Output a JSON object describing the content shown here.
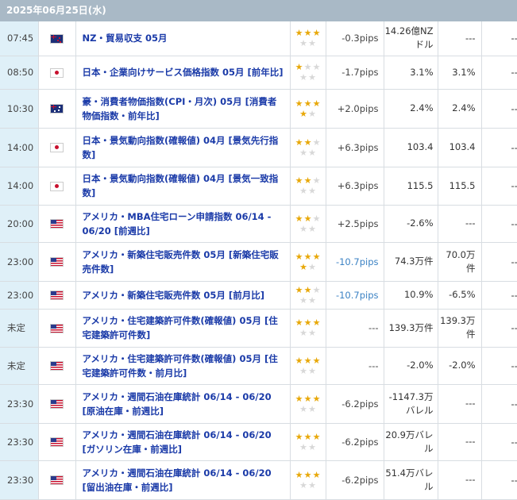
{
  "date_header": "2025年06月25日(水)",
  "rows": [
    {
      "time": "07:45",
      "flag": "nz",
      "name": "NZ・貿易収支 05月",
      "stars_full": 3,
      "stars_half": 0,
      "pips": "-0.3pips",
      "pips_blue": false,
      "result": "14.26億NZドル",
      "forecast": "---",
      "previous": "---",
      "h": 43
    },
    {
      "time": "08:50",
      "flag": "jp",
      "name": "日本・企業向けサービス価格指数 05月 [前年比]",
      "stars_full": 1,
      "stars_half": 0,
      "pips": "-1.7pips",
      "pips_blue": false,
      "result": "3.1%",
      "forecast": "3.1%",
      "previous": "---",
      "h": 42
    },
    {
      "time": "10:30",
      "flag": "au",
      "name": "豪・消費者物価指数(CPI・月次) 05月 [消費者物価指数・前年比]",
      "stars_full": 4,
      "stars_half": 0,
      "pips": "+2.0pips",
      "pips_blue": false,
      "result": "2.4%",
      "forecast": "2.4%",
      "previous": "---",
      "h": 49
    },
    {
      "time": "14:00",
      "flag": "jp",
      "name": "日本・景気動向指数(確報値) 04月 [景気先行指数]",
      "stars_full": 2,
      "stars_half": 0,
      "pips": "+6.3pips",
      "pips_blue": false,
      "result": "103.4",
      "forecast": "103.4",
      "previous": "---",
      "h": 49
    },
    {
      "time": "14:00",
      "flag": "jp",
      "name": "日本・景気動向指数(確報値) 04月 [景気一致指数]",
      "stars_full": 2,
      "stars_half": 0,
      "pips": "+6.3pips",
      "pips_blue": false,
      "result": "115.5",
      "forecast": "115.5",
      "previous": "---",
      "h": 48
    },
    {
      "time": "20:00",
      "flag": "us",
      "name": "アメリカ・MBA住宅ローン申請指数 06/14 - 06/20 [前週比]",
      "stars_full": 2,
      "stars_half": 0,
      "pips": "+2.5pips",
      "pips_blue": false,
      "result": "-2.6%",
      "forecast": "---",
      "previous": "---",
      "h": 47
    },
    {
      "time": "23:00",
      "flag": "us",
      "name": "アメリカ・新築住宅販売件数 05月 [新築住宅販売件数]",
      "stars_full": 4,
      "stars_half": 0,
      "pips": "-10.7pips",
      "pips_blue": true,
      "result": "74.3万件",
      "forecast": "70.0万件",
      "previous": "---",
      "h": 49
    },
    {
      "time": "23:00",
      "flag": "us",
      "name": "アメリカ・新築住宅販売件数 05月 [前月比]",
      "stars_full": 2,
      "stars_half": 0,
      "pips": "-10.7pips",
      "pips_blue": true,
      "result": "10.9%",
      "forecast": "-6.5%",
      "previous": "---",
      "h": 35
    },
    {
      "time": "未定",
      "flag": "us",
      "name": "アメリカ・住宅建築許可件数(確報値) 05月 [住宅建築許可件数]",
      "stars_full": 3,
      "stars_half": 0,
      "pips": "---",
      "pips_blue": false,
      "result": "139.3万件",
      "forecast": "139.3万件",
      "previous": "---",
      "h": 48
    },
    {
      "time": "未定",
      "flag": "us",
      "name": "アメリカ・住宅建築許可件数(確報値) 05月 [住宅建築許可件数・前月比]",
      "stars_full": 3,
      "stars_half": 0,
      "pips": "---",
      "pips_blue": false,
      "result": "-2.0%",
      "forecast": "-2.0%",
      "previous": "---",
      "h": 47
    },
    {
      "time": "23:30",
      "flag": "us",
      "name": "アメリカ・週間石油在庫統計 06/14 - 06/20 [原油在庫・前週比]",
      "stars_full": 3,
      "stars_half": 0,
      "pips": "-6.2pips",
      "pips_blue": false,
      "result": "-1147.3万バレル",
      "forecast": "---",
      "previous": "---",
      "h": 49
    },
    {
      "time": "23:30",
      "flag": "us",
      "name": "アメリカ・週間石油在庫統計 06/14 - 06/20 [ガソリン在庫・前週比]",
      "stars_full": 3,
      "stars_half": 0,
      "pips": "-6.2pips",
      "pips_blue": false,
      "result": "20.9万バレル",
      "forecast": "---",
      "previous": "---",
      "h": 47
    },
    {
      "time": "23:30",
      "flag": "us",
      "name": "アメリカ・週間石油在庫統計 06/14 - 06/20 [留出油在庫・前週比]",
      "stars_full": 3,
      "stars_half": 0,
      "pips": "-6.2pips",
      "pips_blue": false,
      "result": "51.4万バレル",
      "forecast": "---",
      "previous": "---",
      "h": 49
    }
  ]
}
